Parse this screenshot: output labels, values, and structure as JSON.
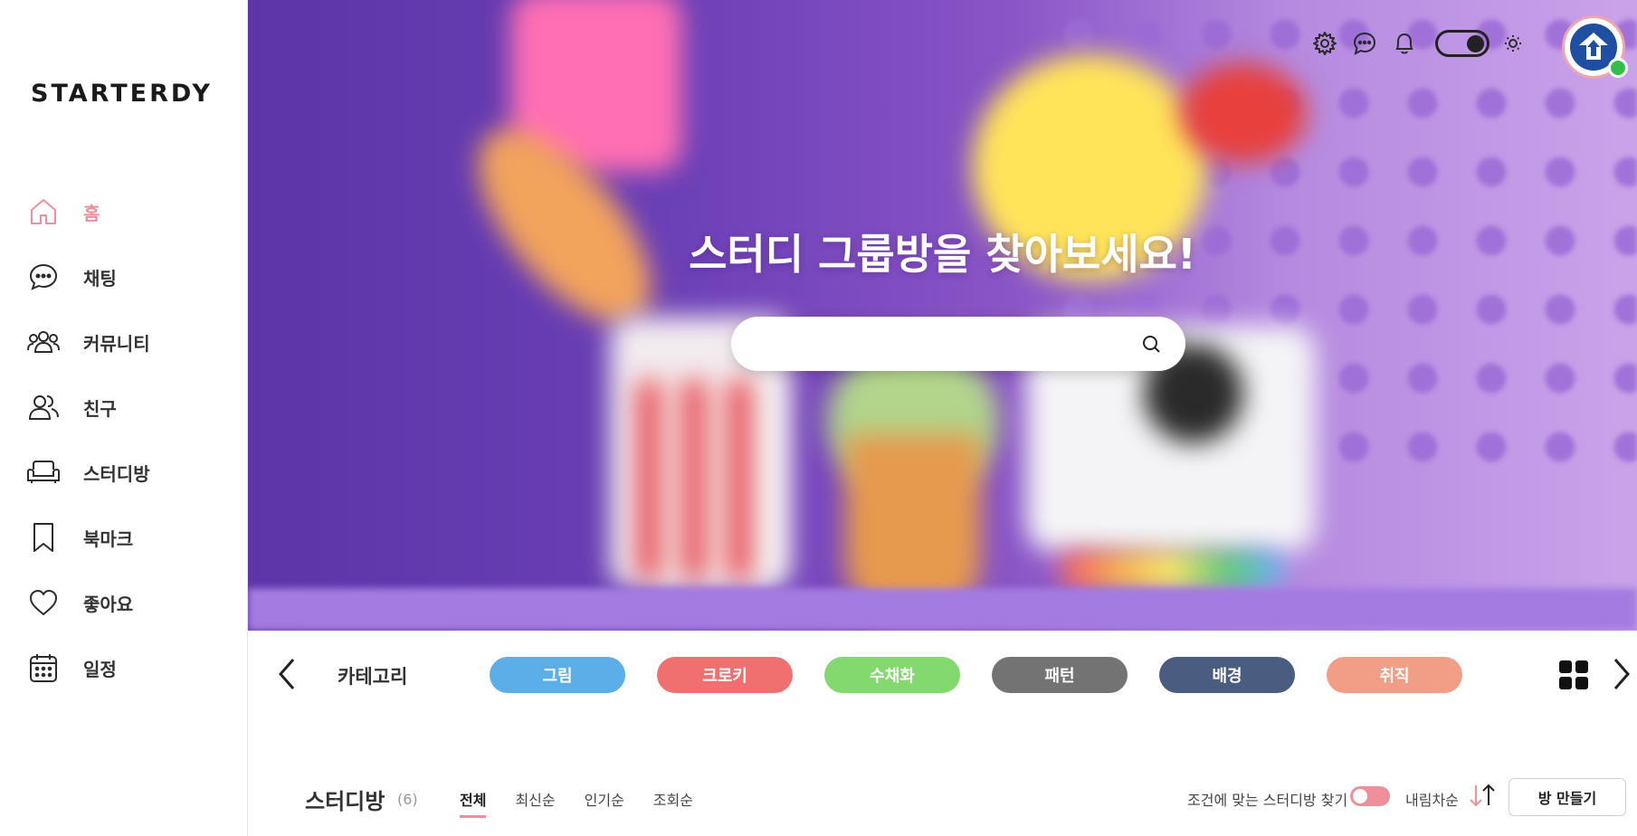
{
  "app": {
    "logo": "STARTERDY"
  },
  "sidebar": {
    "items": [
      {
        "label": "홈",
        "icon": "home-icon",
        "active": true
      },
      {
        "label": "채팅",
        "icon": "chat-icon"
      },
      {
        "label": "커뮤니티",
        "icon": "community-icon"
      },
      {
        "label": "친구",
        "icon": "friends-icon"
      },
      {
        "label": "스터디방",
        "icon": "sofa-icon"
      },
      {
        "label": "북마크",
        "icon": "bookmark-icon"
      },
      {
        "label": "좋아요",
        "icon": "heart-icon"
      },
      {
        "label": "일정",
        "icon": "calendar-icon"
      }
    ]
  },
  "hero": {
    "title": "스터디 그룹방을 찾아보세요!",
    "search_placeholder": ""
  },
  "topbar": {
    "icons": [
      "gear-icon",
      "chat-icon",
      "bell-icon",
      "theme-toggle",
      "sun-icon"
    ],
    "dark_mode": true
  },
  "category": {
    "title": "카테고리",
    "chips": [
      {
        "label": "그림",
        "color": "#5baee8"
      },
      {
        "label": "크로키",
        "color": "#f07070"
      },
      {
        "label": "수채화",
        "color": "#84d96e"
      },
      {
        "label": "패턴",
        "color": "#737373"
      },
      {
        "label": "배경",
        "color": "#4a5d80"
      },
      {
        "label": "취직",
        "color": "#f29d86"
      }
    ]
  },
  "study": {
    "title": "스터디방",
    "count": "(6)",
    "sorts": [
      "전체",
      "최신순",
      "인기순",
      "조회순"
    ],
    "active_sort": "전체",
    "filter_label": "조건에 맞는 스터디방 찾기",
    "order_label": "내림차순",
    "create_button": "방 만들기"
  },
  "colors": {
    "accent": "#ee8f9b",
    "online": "#2fbf4a"
  }
}
